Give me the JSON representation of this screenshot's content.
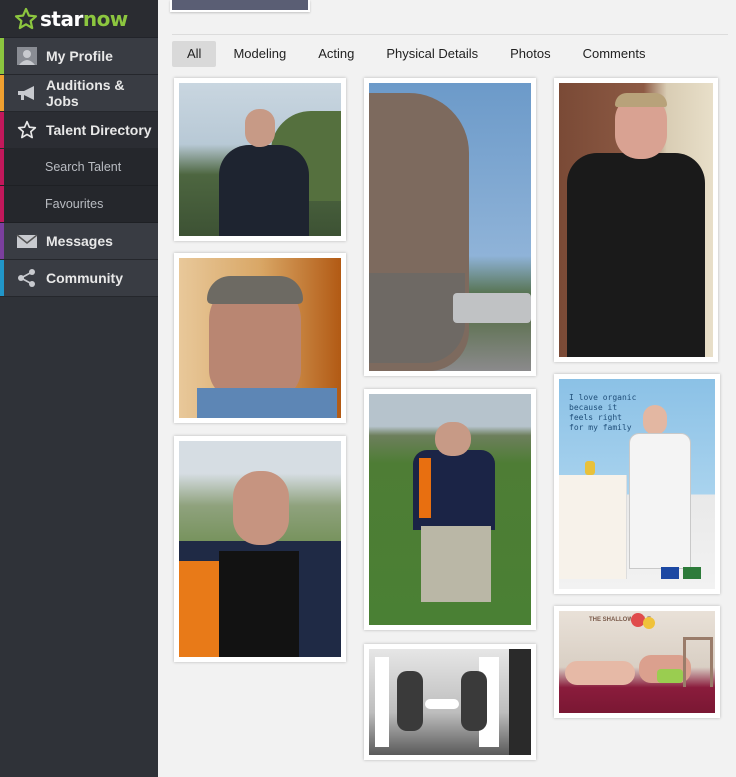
{
  "brand": {
    "part1": "star",
    "part2": "now"
  },
  "sidebar": {
    "items": [
      {
        "label": "My Profile",
        "stripe": "#8cc63f"
      },
      {
        "label": "Auditions & Jobs",
        "stripe": "#f0a030"
      },
      {
        "label": "Talent Directory",
        "stripe": "#c2185b"
      },
      {
        "label": "Messages",
        "stripe": "#7b3f9e"
      },
      {
        "label": "Community",
        "stripe": "#2196c9"
      }
    ],
    "sub_items": [
      {
        "label": "Search Talent"
      },
      {
        "label": "Favourites"
      }
    ]
  },
  "tabs": [
    {
      "label": "All",
      "active": true
    },
    {
      "label": "Modeling"
    },
    {
      "label": "Acting"
    },
    {
      "label": "Physical Details"
    },
    {
      "label": "Photos"
    },
    {
      "label": "Comments"
    }
  ],
  "photos": {
    "ad_text": "I love organic because it feels right for my family",
    "poster_title": "THE SHALLOW SOLE"
  },
  "colors": {
    "accent_green": "#8cc63f",
    "sidebar_bg": "#2f3238"
  }
}
